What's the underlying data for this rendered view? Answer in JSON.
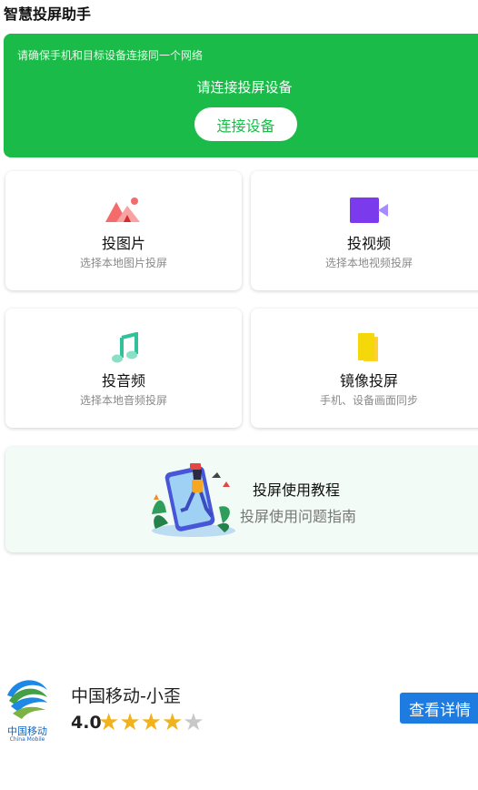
{
  "app": {
    "title": "智慧投屏助手"
  },
  "banner": {
    "tip": "请确保手机和目标设备连接同一个网络",
    "status": "请连接投屏设备",
    "connect_button": "连接设备",
    "color": "#1bbb4a"
  },
  "features": [
    {
      "title": "投图片",
      "subtitle": "选择本地图片投屏",
      "icon": "image-icon"
    },
    {
      "title": "投视频",
      "subtitle": "选择本地视频投屏",
      "icon": "video-icon"
    },
    {
      "title": "投音频",
      "subtitle": "选择本地音频投屏",
      "icon": "music-icon"
    },
    {
      "title": "镜像投屏",
      "subtitle": "手机、设备画面同步",
      "icon": "mirror-icon"
    }
  ],
  "tutorial": {
    "title": "投屏使用教程",
    "subtitle": "投屏使用问题指南"
  },
  "ad": {
    "logo_text": "中国移动",
    "logo_text_en": "China Mobile",
    "name": "中国移动-小歪",
    "rating": "4.0",
    "stars_filled": 4,
    "stars_total": 5,
    "detail_button": "查看详情",
    "button_color": "#1e7ce0"
  }
}
